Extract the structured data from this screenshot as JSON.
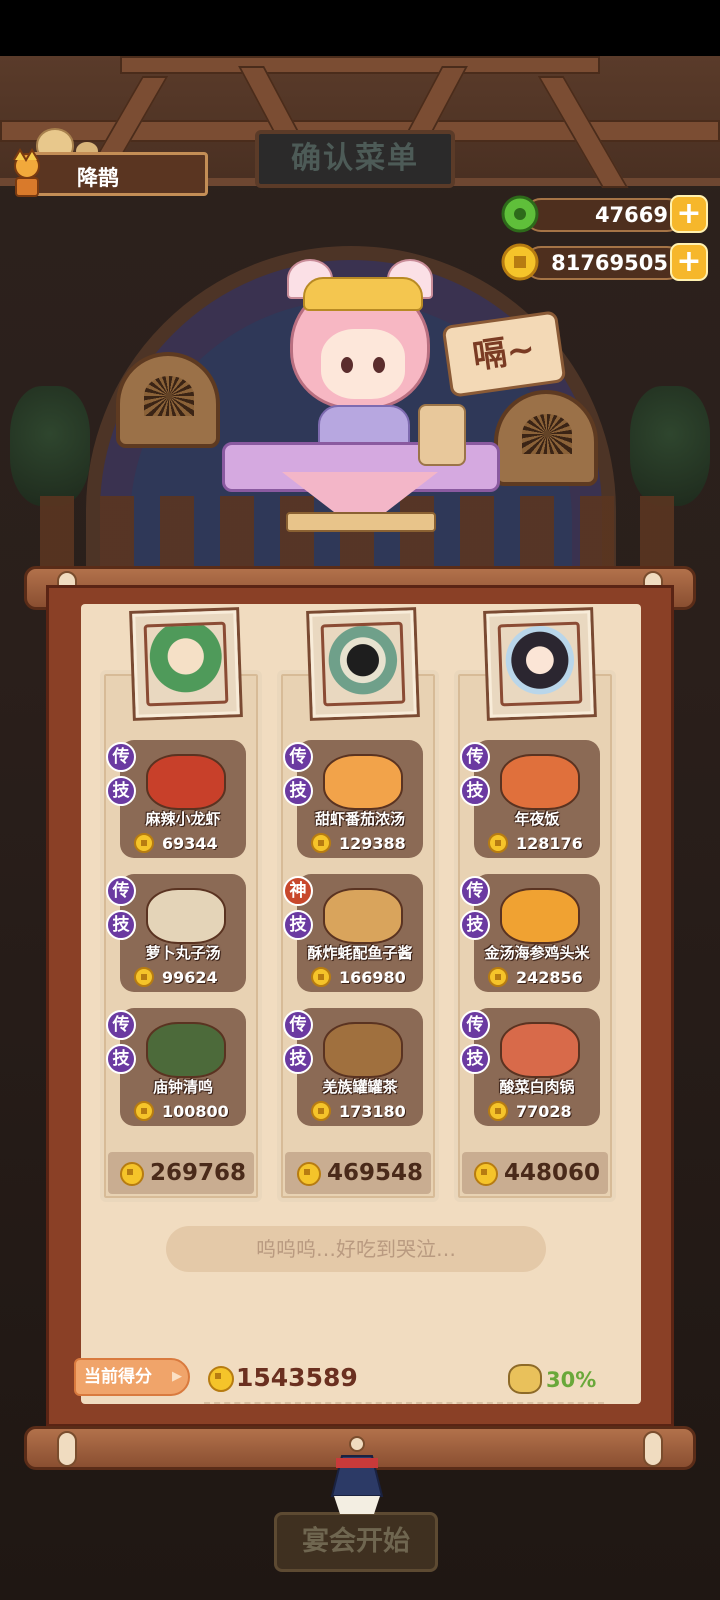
{
  "header": {
    "sign_title": "确认菜单",
    "player_name": "降鹊"
  },
  "currencies": {
    "jade": "47669",
    "coins": "81769505",
    "plus_symbol": "+"
  },
  "character": {
    "speech": "嗝~"
  },
  "columns": [
    {
      "dishes": [
        {
          "badge1": "传",
          "badge2": "技",
          "name": "麻辣小龙虾",
          "price": "69344",
          "img": "#c8402a"
        },
        {
          "badge1": "传",
          "badge2": "技",
          "name": "萝卜丸子汤",
          "price": "99624",
          "img": "#e4d4b8"
        },
        {
          "badge1": "传",
          "badge2": "技",
          "name": "庙钟清鸣",
          "price": "100800",
          "img": "#4c6a3a"
        }
      ],
      "total": "269768"
    },
    {
      "dishes": [
        {
          "badge1": "传",
          "badge2": "技",
          "name": "甜虾番茄浓汤",
          "price": "129388",
          "img": "#f2a34a"
        },
        {
          "badge1": "神",
          "badge2": "技",
          "name": "酥炸蚝配鱼子酱",
          "price": "166980",
          "img": "#d9a45c"
        },
        {
          "badge1": "传",
          "badge2": "技",
          "name": "羌族罐罐茶",
          "price": "173180",
          "img": "#a0703e"
        }
      ],
      "total": "469548"
    },
    {
      "dishes": [
        {
          "badge1": "传",
          "badge2": "技",
          "name": "年夜饭",
          "price": "128176",
          "img": "#e0703c"
        },
        {
          "badge1": "传",
          "badge2": "技",
          "name": "金汤海参鸡头米",
          "price": "242856",
          "img": "#f0a232"
        },
        {
          "badge1": "传",
          "badge2": "技",
          "name": "酸菜白肉锅",
          "price": "77028",
          "img": "#d86a4a"
        }
      ],
      "total": "448060"
    }
  ],
  "quote": "呜呜呜…好吃到哭泣…",
  "score": {
    "label": "当前得分",
    "value": "1543589",
    "bonus": "30%"
  },
  "start_button": "宴会开始",
  "colors": {
    "coin": "#f5c42a",
    "legend_badge": "#6b3aa1",
    "divine_badge": "#c8482c",
    "bonus_green": "#6aa83a"
  }
}
